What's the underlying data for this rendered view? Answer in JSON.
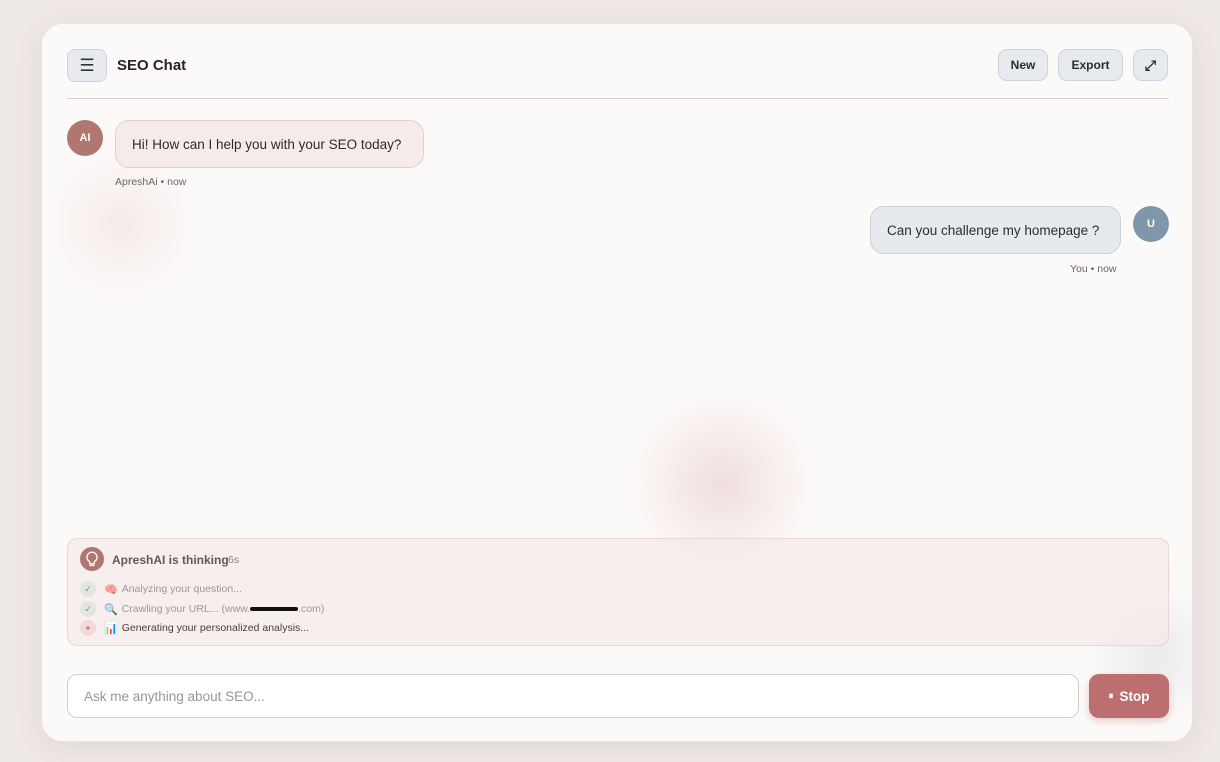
{
  "header": {
    "menu_icon": "☰",
    "title": "SEO Chat",
    "new_label": "New",
    "export_label": "Export",
    "expand_icon": "⤢"
  },
  "messages": [
    {
      "role": "ai",
      "avatar": "AI",
      "text": "Hi! How can I help you with your SEO today?",
      "meta": "ApreshAi • now"
    },
    {
      "role": "user",
      "avatar": "U",
      "text": "Can you challenge my homepage ?",
      "meta": "You • now"
    }
  ],
  "thinking": {
    "title": "ApreshAI is thinking",
    "elapsed": "6s",
    "steps": [
      {
        "mark": "✓",
        "emoji": "🧠",
        "text": "Analyzing your question...",
        "status": "done"
      },
      {
        "mark": "✓",
        "emoji": "🔍",
        "text_before": "Crawling your URL... (www.",
        "text_after": ".com)",
        "status": "done"
      },
      {
        "mark": "•",
        "emoji": "📊",
        "text": "Generating your personalized analysis...",
        "status": "active"
      }
    ]
  },
  "composer": {
    "placeholder": "Ask me anything about SEO...",
    "value": "",
    "stop_icon": "⏸",
    "stop_label": "Stop"
  },
  "colors": {
    "accent": "#bd6e6e",
    "ai_avatar": "#b07771",
    "user_avatar": "#7f97ab"
  }
}
